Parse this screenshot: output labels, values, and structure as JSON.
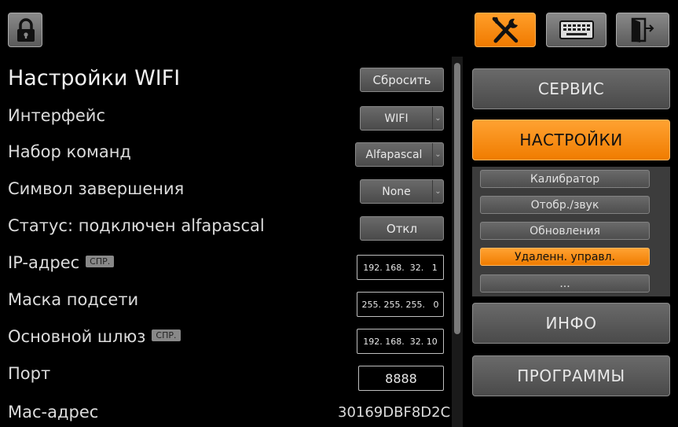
{
  "toolbar": {
    "lock_icon": "lock-icon",
    "service_icon": "wrench-screwdriver-icon",
    "keyboard_icon": "keyboard-icon",
    "exit_icon": "exit-door-icon",
    "accent": "#f28400"
  },
  "settings": {
    "title": "Настройки WIFI",
    "reset_label": "Сбросить",
    "rows": {
      "interface": {
        "label": "Интерфейс",
        "value": "WIFI"
      },
      "command_set": {
        "label": "Набор команд",
        "value": "Alfapascal"
      },
      "terminator": {
        "label": "Символ завершения",
        "value": "None"
      },
      "status": {
        "label": "Статус: подключен alfapascal",
        "button": "Откл"
      },
      "ip": {
        "label": "IP-адрес",
        "help": "СПР.",
        "value": "192. 168.  32.   1"
      },
      "mask": {
        "label": "Маска подсети",
        "value": "255. 255. 255.   0"
      },
      "gateway": {
        "label": "Основной шлюз",
        "help": "СПР.",
        "value": "192. 168.  32. 10"
      },
      "port": {
        "label": "Порт",
        "value": "8888"
      },
      "mac": {
        "label": "Мас-адрес",
        "value": "30169DBF8D2C"
      }
    }
  },
  "menu": {
    "service": "СЕРВИС",
    "settings": "НАСТРОЙКИ",
    "submenu": [
      "Калибратор",
      "Отобр./звук",
      "Обновления",
      "Удаленн. управл.",
      "..."
    ],
    "info": "ИНФО",
    "programs": "ПРОГРАММЫ"
  }
}
